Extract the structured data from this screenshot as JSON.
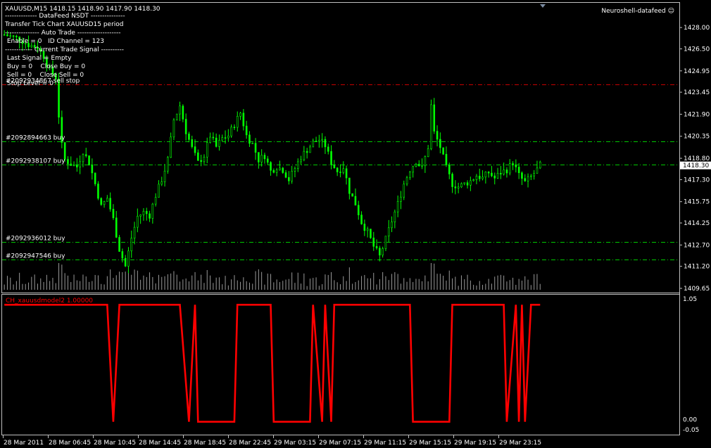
{
  "window": {
    "header": "XAUUSD,M15  1418.15 1418.90 1417.90 1418.30",
    "badge": "Neuroshell-datafeed ☺"
  },
  "overlay_lines": [
    "-------------- DataFeed NSDT ---------------",
    "Transfer Tick Chart XAUUSD15 period",
    "--------------- Auto Trade -------------------",
    " Enable = 0   ID Channel = 123",
    "------------ Current Trade Signal ----------",
    " Last Signal = Empty",
    " Buy = 0    Close Buy = 0",
    " Sell = 0    Close Sell = 0",
    " Stop Level = 0"
  ],
  "colors": {
    "background": "#000000",
    "candle": "#00ff00",
    "order_line": "#00c800",
    "stop_line": "#c80000",
    "volume": "#999999",
    "indicator": "#ff0000",
    "price_box": "#ffffff",
    "axis": "#c0c0c0"
  },
  "chart_data": [
    {
      "type": "candlestick",
      "symbol": "XAUUSD",
      "timeframe": "M15",
      "ohlc_current": {
        "open": 1418.15,
        "high": 1418.9,
        "low": 1417.9,
        "close": 1418.3
      },
      "current_price": "1418.30",
      "ylim": [
        1409.65,
        1428.6
      ],
      "y_ticks": [
        "1428.00",
        "1426.50",
        "1424.95",
        "1423.45",
        "1421.90",
        "1420.35",
        "1418.80",
        "1417.30",
        "1415.75",
        "1414.25",
        "1412.70",
        "1411.20",
        "1409.65"
      ],
      "x_ticks": [
        "28 Mar 2011",
        "28 Mar 06:45",
        "28 Mar 10:45",
        "28 Mar 14:45",
        "28 Mar 18:45",
        "28 Mar 22:45",
        "29 Mar 03:15",
        "29 Mar 07:15",
        "29 Mar 11:15",
        "29 Mar 15:15",
        "29 Mar 19:15",
        "29 Mar 23:15"
      ],
      "close_path": [
        [
          0,
          1427.5
        ],
        [
          5,
          1427.2
        ],
        [
          8,
          1426.8
        ],
        [
          11,
          1426.6
        ],
        [
          13,
          1426.0
        ],
        [
          15,
          1425.0
        ],
        [
          17,
          1424.5
        ],
        [
          18,
          1421.8
        ],
        [
          19,
          1419.7
        ],
        [
          20,
          1418.7
        ],
        [
          22,
          1418.4
        ],
        [
          24,
          1418.2
        ],
        [
          26,
          1419.3
        ],
        [
          28,
          1418.5
        ],
        [
          30,
          1417.0
        ],
        [
          32,
          1415.4
        ],
        [
          34,
          1416.0
        ],
        [
          36,
          1414.5
        ],
        [
          38,
          1412.4
        ],
        [
          40,
          1411.2
        ],
        [
          42,
          1413.2
        ],
        [
          44,
          1414.7
        ],
        [
          46,
          1415.0
        ],
        [
          48,
          1414.8
        ],
        [
          50,
          1416.2
        ],
        [
          52,
          1417.3
        ],
        [
          54,
          1418.7
        ],
        [
          56,
          1421.5
        ],
        [
          58,
          1422.5
        ],
        [
          60,
          1420.7
        ],
        [
          62,
          1419.5
        ],
        [
          64,
          1418.5
        ],
        [
          66,
          1419.0
        ],
        [
          68,
          1420.4
        ],
        [
          70,
          1419.6
        ],
        [
          72,
          1420.2
        ],
        [
          74,
          1420.4
        ],
        [
          76,
          1421.2
        ],
        [
          78,
          1422.0
        ],
        [
          80,
          1420.4
        ],
        [
          82,
          1419.8
        ],
        [
          84,
          1418.7
        ],
        [
          86,
          1419.0
        ],
        [
          88,
          1417.9
        ],
        [
          90,
          1418.2
        ],
        [
          92,
          1418.0
        ],
        [
          94,
          1417.3
        ],
        [
          96,
          1418.1
        ],
        [
          98,
          1418.9
        ],
        [
          100,
          1419.4
        ],
        [
          102,
          1419.9
        ],
        [
          104,
          1420.1
        ],
        [
          106,
          1419.7
        ],
        [
          108,
          1418.5
        ],
        [
          110,
          1417.9
        ],
        [
          112,
          1418.2
        ],
        [
          114,
          1416.5
        ],
        [
          116,
          1415.6
        ],
        [
          118,
          1414.3
        ],
        [
          120,
          1413.6
        ],
        [
          122,
          1412.6
        ],
        [
          124,
          1411.9
        ],
        [
          126,
          1413.1
        ],
        [
          128,
          1414.4
        ],
        [
          130,
          1415.6
        ],
        [
          132,
          1417.0
        ],
        [
          134,
          1418.0
        ],
        [
          136,
          1418.6
        ],
        [
          138,
          1418.1
        ],
        [
          140,
          1419.6
        ],
        [
          141,
          1422.5
        ],
        [
          142,
          1420.6
        ],
        [
          144,
          1419.6
        ],
        [
          146,
          1418.1
        ],
        [
          148,
          1417.0
        ],
        [
          150,
          1416.8
        ],
        [
          152,
          1417.0
        ],
        [
          154,
          1417.2
        ],
        [
          156,
          1417.6
        ],
        [
          158,
          1417.4
        ],
        [
          160,
          1417.8
        ],
        [
          162,
          1417.4
        ],
        [
          164,
          1417.8
        ],
        [
          166,
          1418.0
        ],
        [
          168,
          1418.5
        ],
        [
          170,
          1417.6
        ],
        [
          172,
          1417.1
        ],
        [
          174,
          1417.5
        ],
        [
          176,
          1418.0
        ],
        [
          177,
          1418.3
        ]
      ],
      "order_lines": [
        {
          "label": "#2092894663 buy",
          "price": 1420.0
        },
        {
          "label": "#2092938107 buy",
          "price": 1418.35
        },
        {
          "label": "#2092936012 buy",
          "price": 1412.9
        },
        {
          "label": "#2092947546 buy",
          "price": 1411.7
        }
      ],
      "stop_level": {
        "label": "#2092934867 sell stop",
        "price": 1424.0
      }
    },
    {
      "type": "line",
      "name": "CH_xauusdmodel2 1.00000",
      "ylim": [
        -0.05,
        1.05
      ],
      "y_ticks": [
        "1.05",
        "0.00",
        "-0.05"
      ],
      "x": [
        0,
        34,
        36,
        38,
        58,
        61,
        63,
        64,
        76,
        77,
        88,
        89,
        101,
        102,
        105,
        106,
        108,
        109,
        134,
        135,
        147,
        148,
        165,
        166,
        169,
        170,
        171,
        172,
        174,
        175,
        177
      ],
      "values": [
        1,
        1,
        0,
        1,
        1,
        0,
        1,
        0,
        0,
        1,
        1,
        0,
        0,
        1,
        0,
        1,
        0,
        1,
        1,
        0,
        0,
        1,
        1,
        0,
        1,
        0,
        1,
        0,
        1,
        1,
        1
      ]
    }
  ]
}
